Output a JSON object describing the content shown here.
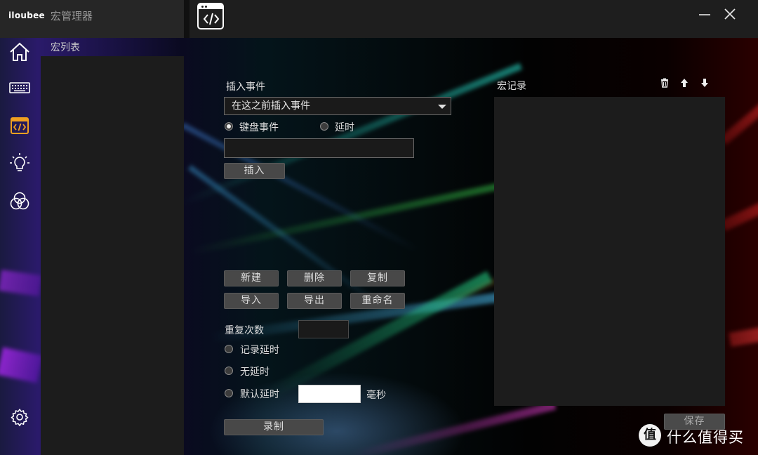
{
  "titlebar": {
    "brand": "iloubee",
    "app_title": "宏管理器"
  },
  "nav": {
    "items": [
      {
        "name": "home",
        "icon": "home-icon"
      },
      {
        "name": "keyboard",
        "icon": "keyboard-icon"
      },
      {
        "name": "macro",
        "icon": "code-icon",
        "active": true
      },
      {
        "name": "lighting",
        "icon": "lightbulb-icon"
      },
      {
        "name": "color",
        "icon": "color-circles-icon"
      },
      {
        "name": "settings",
        "icon": "gear-icon"
      }
    ],
    "active_color": "#f0a020"
  },
  "macro_list": {
    "label": "宏列表"
  },
  "insert": {
    "label": "插入事件",
    "select_value": "在这之前插入事件",
    "radio_keyboard_label": "键盘事件",
    "radio_keyboard_selected": true,
    "radio_delay_label": "延时",
    "radio_delay_selected": false,
    "event_input_value": "",
    "insert_button": "插入"
  },
  "actions": {
    "new": "新建",
    "delete": "删除",
    "copy": "复制",
    "import": "导入",
    "export": "导出",
    "rename": "重命名"
  },
  "repeat": {
    "label": "重复次数",
    "value": ""
  },
  "delay_options": {
    "record_delay": "记录延时",
    "no_delay": "无延时",
    "default_delay": "默认延时",
    "default_delay_value": "",
    "unit": "毫秒"
  },
  "record_button": "录制",
  "record_panel": {
    "label": "宏记录",
    "tools": [
      "trash-icon",
      "arrow-up-icon",
      "arrow-down-icon"
    ],
    "save_button": "保存"
  },
  "watermark": {
    "badge": "值",
    "text": "什么值得买"
  }
}
